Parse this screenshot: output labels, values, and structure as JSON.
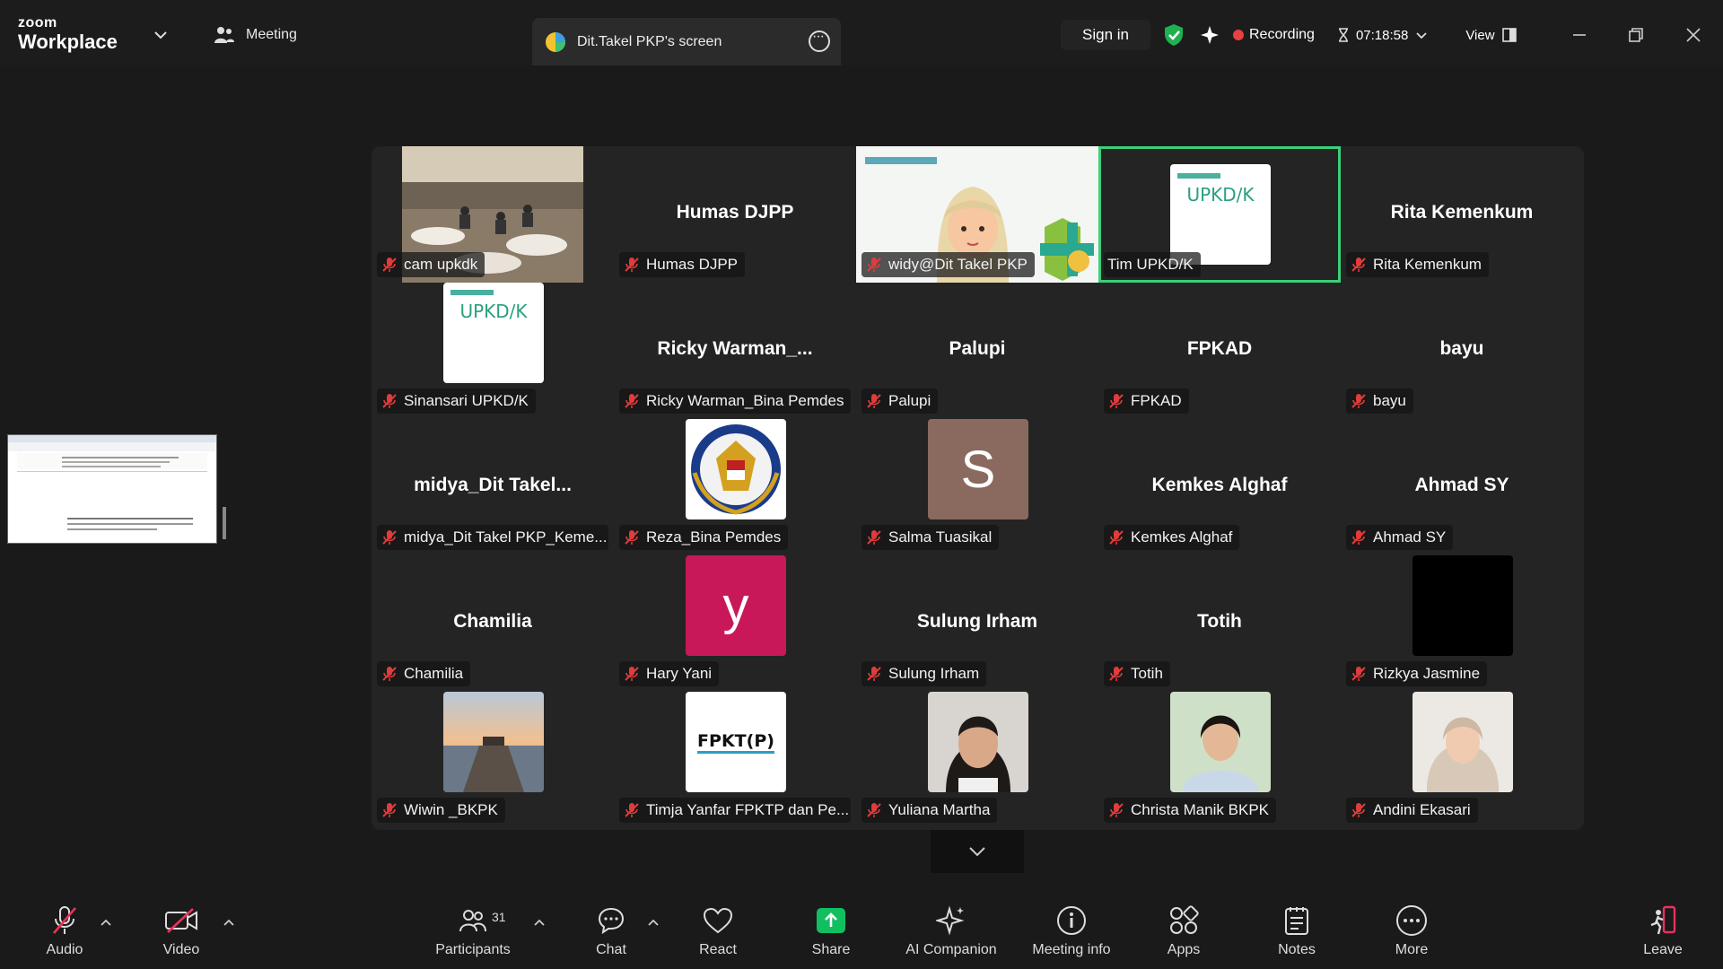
{
  "titlebar": {
    "logo_top": "zoom",
    "logo_bottom": "Workplace",
    "meeting_label": "Meeting",
    "screen_tab_label": "Dit.Takel PKP's screen",
    "signin_label": "Sign in",
    "recording_label": "Recording",
    "timer": "07:18:58",
    "view_label": "View"
  },
  "tiles": [
    {
      "label": "cam upkdk",
      "center": ""
    },
    {
      "label": "Humas DJPP",
      "center": "Humas DJPP"
    },
    {
      "label": "widy@Dit Takel PKP",
      "center": ""
    },
    {
      "label": "Tim UPKD/K",
      "center": ""
    },
    {
      "label": "Rita Kemenkum",
      "center": "Rita Kemenkum"
    },
    {
      "label": "Sinansari UPKD/K",
      "center": ""
    },
    {
      "label": "Ricky Warman_Bina Pemdes",
      "center": "Ricky  Warman_..."
    },
    {
      "label": "Palupi",
      "center": "Palupi"
    },
    {
      "label": "FPKAD",
      "center": "FPKAD"
    },
    {
      "label": "bayu",
      "center": "bayu"
    },
    {
      "label": "midya_Dit Takel PKP_Keme...",
      "center": "midya_Dit  Takel..."
    },
    {
      "label": "Reza_Bina Pemdes",
      "center": ""
    },
    {
      "label": "Salma Tuasikal",
      "center": ""
    },
    {
      "label": "Kemkes Alghaf",
      "center": "Kemkes Alghaf"
    },
    {
      "label": "Ahmad SY",
      "center": "Ahmad SY"
    },
    {
      "label": "Chamilia",
      "center": "Chamilia"
    },
    {
      "label": "Hary Yani",
      "center": ""
    },
    {
      "label": "Sulung Irham",
      "center": "Sulung Irham"
    },
    {
      "label": "Totih",
      "center": "Totih"
    },
    {
      "label": "Rizkya Jasmine",
      "center": ""
    },
    {
      "label": "Wiwin _BKPK",
      "center": ""
    },
    {
      "label": "Timja Yanfar FPKTP dan Pe...",
      "center": ""
    },
    {
      "label": "Yuliana Martha",
      "center": ""
    },
    {
      "label": "Christa Manik BKPK",
      "center": ""
    },
    {
      "label": "Andini Ekasari",
      "center": ""
    }
  ],
  "avatars": {
    "salma_letter": "S",
    "hary_letter": "y",
    "upkdk_text": "UPKD/K",
    "fpktp_text": "FPKT(P)"
  },
  "toolbar": {
    "audio": "Audio",
    "video": "Video",
    "participants": "Participants",
    "participants_count": "31",
    "chat": "Chat",
    "react": "React",
    "share": "Share",
    "ai_companion": "AI Companion",
    "meeting_info": "Meeting info",
    "apps": "Apps",
    "notes": "Notes",
    "more": "More",
    "leave": "Leave"
  },
  "colors": {
    "active_border": "#3ad07a",
    "recording": "#e84040",
    "share_green": "#10c060",
    "hary_avatar": "#c8185a",
    "salma_avatar": "#8a6a5e"
  }
}
